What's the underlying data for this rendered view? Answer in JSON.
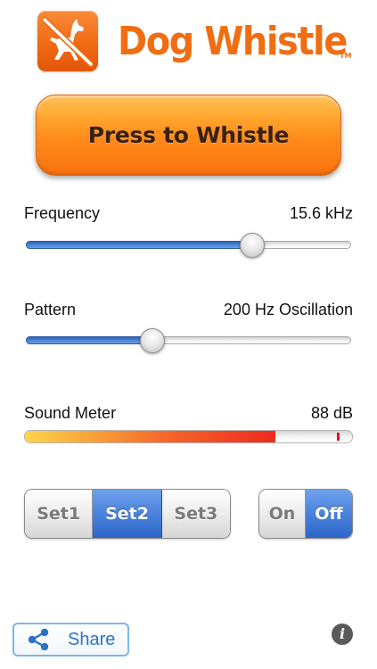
{
  "header": {
    "title": "Dog Whistle",
    "trademark": "TM",
    "logo_icon": "no-dog-icon"
  },
  "whistle_button": {
    "label": "Press to Whistle"
  },
  "frequency": {
    "label": "Frequency",
    "value_text": "15.6 kHz",
    "slider_fraction": 0.695
  },
  "pattern": {
    "label": "Pattern",
    "value_text": "200 Hz Oscillation",
    "slider_fraction": 0.39
  },
  "sound_meter": {
    "label": "Sound Meter",
    "value_text": "88 dB",
    "level_fraction": 0.765,
    "peak_fraction": 0.955
  },
  "sets": {
    "options": [
      "Set1",
      "Set2",
      "Set3"
    ],
    "selected": "Set2"
  },
  "power": {
    "options": [
      "On",
      "Off"
    ],
    "selected": "Off"
  },
  "share": {
    "label": "Share",
    "icon": "share-icon"
  },
  "info": {
    "icon": "info-icon",
    "glyph": "i"
  },
  "colors": {
    "brand_orange": "#f06d12",
    "selected_blue": "#4a82dc",
    "link_blue": "#2a73c4"
  }
}
